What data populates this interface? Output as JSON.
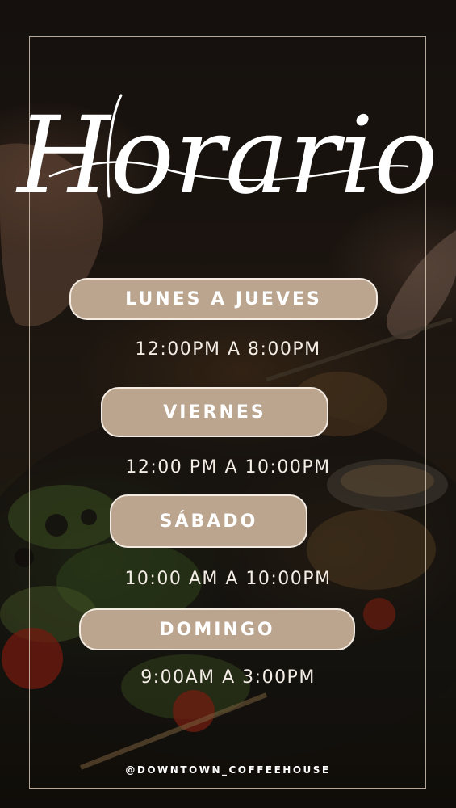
{
  "title": "Horario",
  "schedule": [
    {
      "day": "LUNES A JUEVES",
      "hours": "12:00PM A 8:00PM"
    },
    {
      "day": "VIERNES",
      "hours": "12:00 PM A 10:00PM"
    },
    {
      "day": "SÁBADO",
      "hours": "10:00 AM A 10:00PM"
    },
    {
      "day": "DOMINGO",
      "hours": "9:00AM A 3:00PM"
    }
  ],
  "handle": "@DOWNTOWN_COFFEEHOUSE",
  "colors": {
    "pill": "#bba58f",
    "pill_border": "#f4ece2",
    "text": "#f3ede6",
    "frame": "#ecdcc8"
  }
}
